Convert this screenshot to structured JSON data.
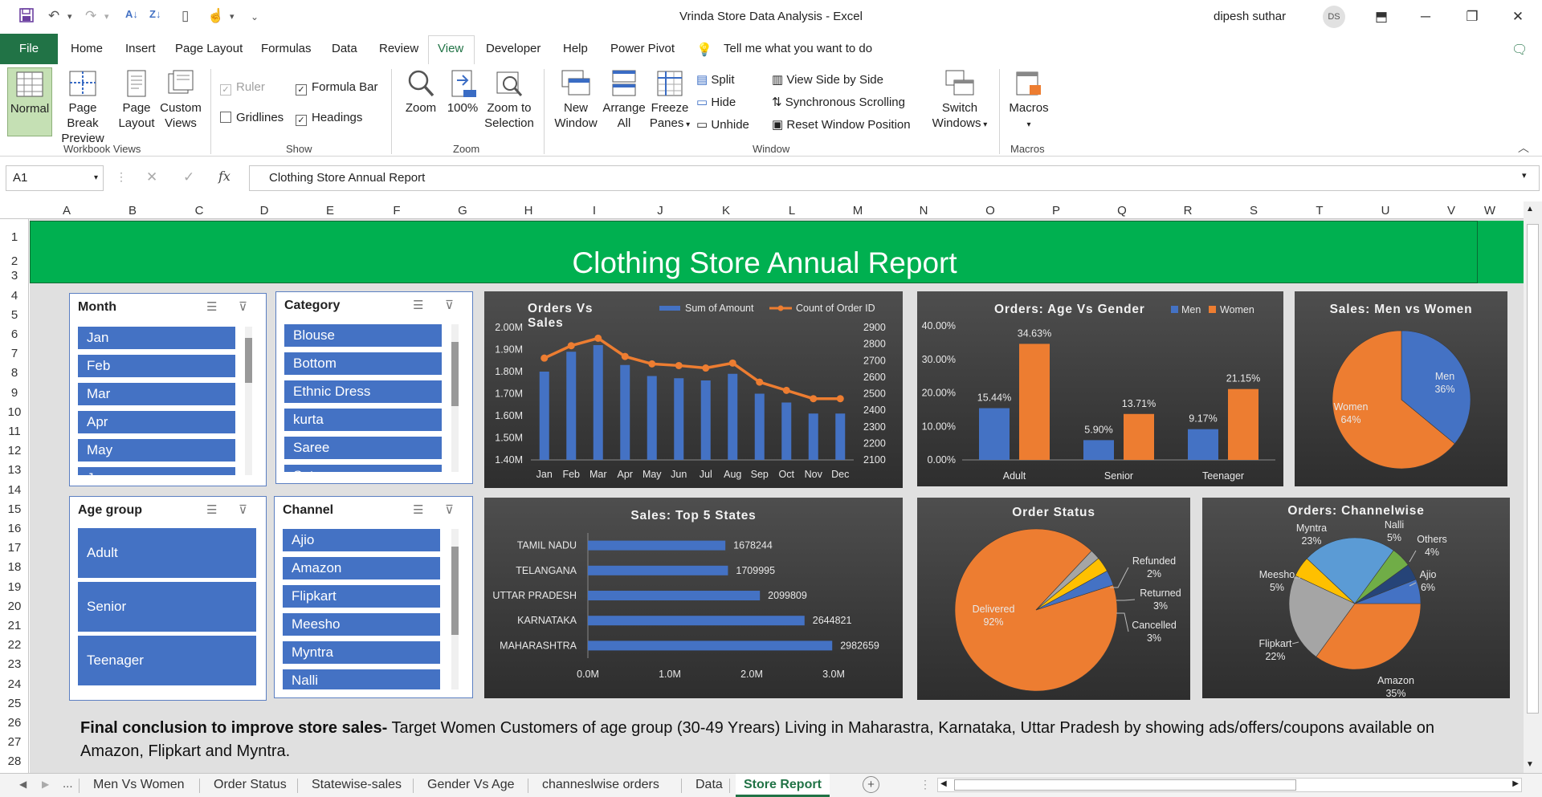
{
  "app": {
    "doc_title": "Vrinda Store Data Analysis  -  Excel",
    "user": "dipesh suthar",
    "avatar_initials": "DS"
  },
  "menu": {
    "file": "File",
    "tabs": [
      "Home",
      "Insert",
      "Page Layout",
      "Formulas",
      "Data",
      "Review",
      "View",
      "Developer",
      "Help",
      "Power Pivot"
    ],
    "tell_me": "Tell me what you want to do"
  },
  "ribbon": {
    "workbook_views": {
      "label": "Workbook Views",
      "normal": "Normal",
      "page_break": [
        "Page Break",
        "Preview"
      ],
      "page_layout": [
        "Page",
        "Layout"
      ],
      "custom_views": [
        "Custom",
        "Views"
      ]
    },
    "show": {
      "label": "Show",
      "ruler": "Ruler",
      "formula_bar": "Formula Bar",
      "gridlines": "Gridlines",
      "headings": "Headings",
      "ruler_checked": true,
      "formula_bar_checked": true,
      "gridlines_checked": false,
      "headings_checked": true
    },
    "zoom": {
      "label": "Zoom",
      "zoom": "Zoom",
      "hundred": "100%",
      "zoom_sel": [
        "Zoom to",
        "Selection"
      ]
    },
    "window": {
      "label": "Window",
      "new_window": [
        "New",
        "Window"
      ],
      "arrange_all": [
        "Arrange",
        "All"
      ],
      "freeze": [
        "Freeze",
        "Panes"
      ],
      "split": "Split",
      "hide": "Hide",
      "unhide": "Unhide",
      "side_by_side": "View Side by Side",
      "sync_scroll": "Synchronous Scrolling",
      "reset_pos": "Reset Window Position",
      "switch": [
        "Switch",
        "Windows"
      ]
    },
    "macros": {
      "label": "Macros",
      "macros": "Macros"
    }
  },
  "formula": {
    "cell": "A1",
    "content": "Clothing Store Annual Report",
    "fx": "fx"
  },
  "grid": {
    "columns": [
      "A",
      "B",
      "C",
      "D",
      "E",
      "F",
      "G",
      "H",
      "I",
      "J",
      "K",
      "L",
      "M",
      "N",
      "O",
      "P",
      "Q",
      "R",
      "S",
      "T",
      "U",
      "V",
      "W"
    ],
    "rows": [
      "1",
      "2",
      "3",
      "4",
      "5",
      "6",
      "7",
      "8",
      "9",
      "10",
      "11",
      "12",
      "13",
      "14",
      "15",
      "16",
      "17",
      "18",
      "19",
      "20",
      "21",
      "22",
      "23",
      "24",
      "25",
      "26",
      "27",
      "28"
    ]
  },
  "report_title": "Clothing Store Annual Report",
  "slicers": {
    "month": {
      "title": "Month",
      "items": [
        "Jan",
        "Feb",
        "Mar",
        "Apr",
        "May",
        "Jun"
      ]
    },
    "category": {
      "title": "Category",
      "items": [
        "Blouse",
        "Bottom",
        "Ethnic Dress",
        "kurta",
        "Saree",
        "Set"
      ]
    },
    "age_group": {
      "title": "Age group",
      "items": [
        "Adult",
        "Senior",
        "Teenager"
      ]
    },
    "channel": {
      "title": "Channel",
      "items": [
        "Ajio",
        "Amazon",
        "Flipkart",
        "Meesho",
        "Myntra",
        "Nalli"
      ]
    }
  },
  "chart_data": [
    {
      "type": "line",
      "title": "Orders Vs Sales",
      "categories": [
        "Jan",
        "Feb",
        "Mar",
        "Apr",
        "May",
        "Jun",
        "Jul",
        "Aug",
        "Sep",
        "Oct",
        "Nov",
        "Dec"
      ],
      "series": [
        {
          "name": "Sum of Amount",
          "type": "bar",
          "values": [
            1800000,
            1890000,
            1920000,
            1830000,
            1780000,
            1770000,
            1760000,
            1790000,
            1700000,
            1660000,
            1610000,
            1610000
          ]
        },
        {
          "name": "Count of Order ID",
          "type": "line",
          "axis": "secondary",
          "values": [
            2715,
            2790,
            2835,
            2725,
            2680,
            2670,
            2655,
            2685,
            2570,
            2520,
            2470,
            2470
          ]
        }
      ],
      "y_ticks": [
        "2.00M",
        "1.90M",
        "1.80M",
        "1.70M",
        "1.60M",
        "1.50M",
        "1.40M"
      ],
      "y_min": 1400000,
      "y_max": 2000000,
      "y2_ticks": [
        "2900",
        "2800",
        "2700",
        "2600",
        "2500",
        "2400",
        "2300",
        "2200",
        "2100"
      ],
      "y2_min": 2100,
      "y2_max": 2900,
      "legend": "top"
    },
    {
      "type": "bar",
      "title": "Orders: Age Vs Gender",
      "categories": [
        "Adult",
        "Senior",
        "Teenager"
      ],
      "series": [
        {
          "name": "Men",
          "values": [
            15.44,
            5.9,
            9.17
          ],
          "labels": [
            "15.44%",
            "5.90%",
            "9.17%"
          ]
        },
        {
          "name": "Women",
          "values": [
            34.63,
            13.71,
            21.15
          ],
          "labels": [
            "34.63%",
            "13.71%",
            "21.15%"
          ]
        }
      ],
      "y_ticks": [
        "40.00%",
        "30.00%",
        "20.00%",
        "10.00%",
        "0.00%"
      ],
      "ylim": [
        0,
        40
      ],
      "legend": "top-right"
    },
    {
      "type": "pie",
      "title": "Sales: Men vs Women",
      "slices": [
        {
          "name": "Men",
          "value": 36,
          "label": "36%"
        },
        {
          "name": "Women",
          "value": 64,
          "label": "64%"
        }
      ]
    },
    {
      "type": "bar",
      "orientation": "horizontal",
      "title": "Sales: Top 5 States",
      "categories": [
        "TAMIL NADU",
        "TELANGANA",
        "UTTAR PRADESH",
        "KARNATAKA",
        "MAHARASHTRA"
      ],
      "values": [
        1678244,
        1709995,
        2099809,
        2644821,
        2982659
      ],
      "x_ticks": [
        "0.0M",
        "1.0M",
        "2.0M",
        "3.0M"
      ],
      "xlim": [
        0,
        3000000
      ]
    },
    {
      "type": "pie",
      "title": "Order Status",
      "slices": [
        {
          "name": "Delivered",
          "value": 92,
          "label": "92%"
        },
        {
          "name": "Refunded",
          "value": 2,
          "label": "2%"
        },
        {
          "name": "Returned",
          "value": 3,
          "label": "3%"
        },
        {
          "name": "Cancelled",
          "value": 3,
          "label": "3%"
        }
      ]
    },
    {
      "type": "pie",
      "title": "Orders: Channelwise",
      "slices": [
        {
          "name": "Amazon",
          "value": 35,
          "label": "35%"
        },
        {
          "name": "Flipkart",
          "value": 22,
          "label": "22%"
        },
        {
          "name": "Meesho",
          "value": 5,
          "label": "5%"
        },
        {
          "name": "Myntra",
          "value": 23,
          "label": "23%"
        },
        {
          "name": "Nalli",
          "value": 5,
          "label": "5%"
        },
        {
          "name": "Others",
          "value": 4,
          "label": "4%"
        },
        {
          "name": "Ajio",
          "value": 6,
          "label": "6%"
        }
      ]
    }
  ],
  "conclusion": {
    "bold": "Final conclusion to improve store sales-",
    "text": " Target Women Customers of age group (30-49 Yrears) Living in Maharastra, Karnataka, Uttar Pradesh by showing ads/offers/coupons available on Amazon, Flipkart and Myntra."
  },
  "sheet_tabs": {
    "items": [
      "Men Vs Women",
      "Order Status",
      "Statewise-sales",
      "Gender Vs Age",
      "channeslwise orders",
      "Data",
      "Store Report"
    ],
    "active": "Store Report",
    "ellipsis": "..."
  },
  "colors": {
    "excel_green": "#217346",
    "banner": "#00b050",
    "men": "#4472c4",
    "women": "#ed7d31",
    "slicer": "#4472c4"
  }
}
